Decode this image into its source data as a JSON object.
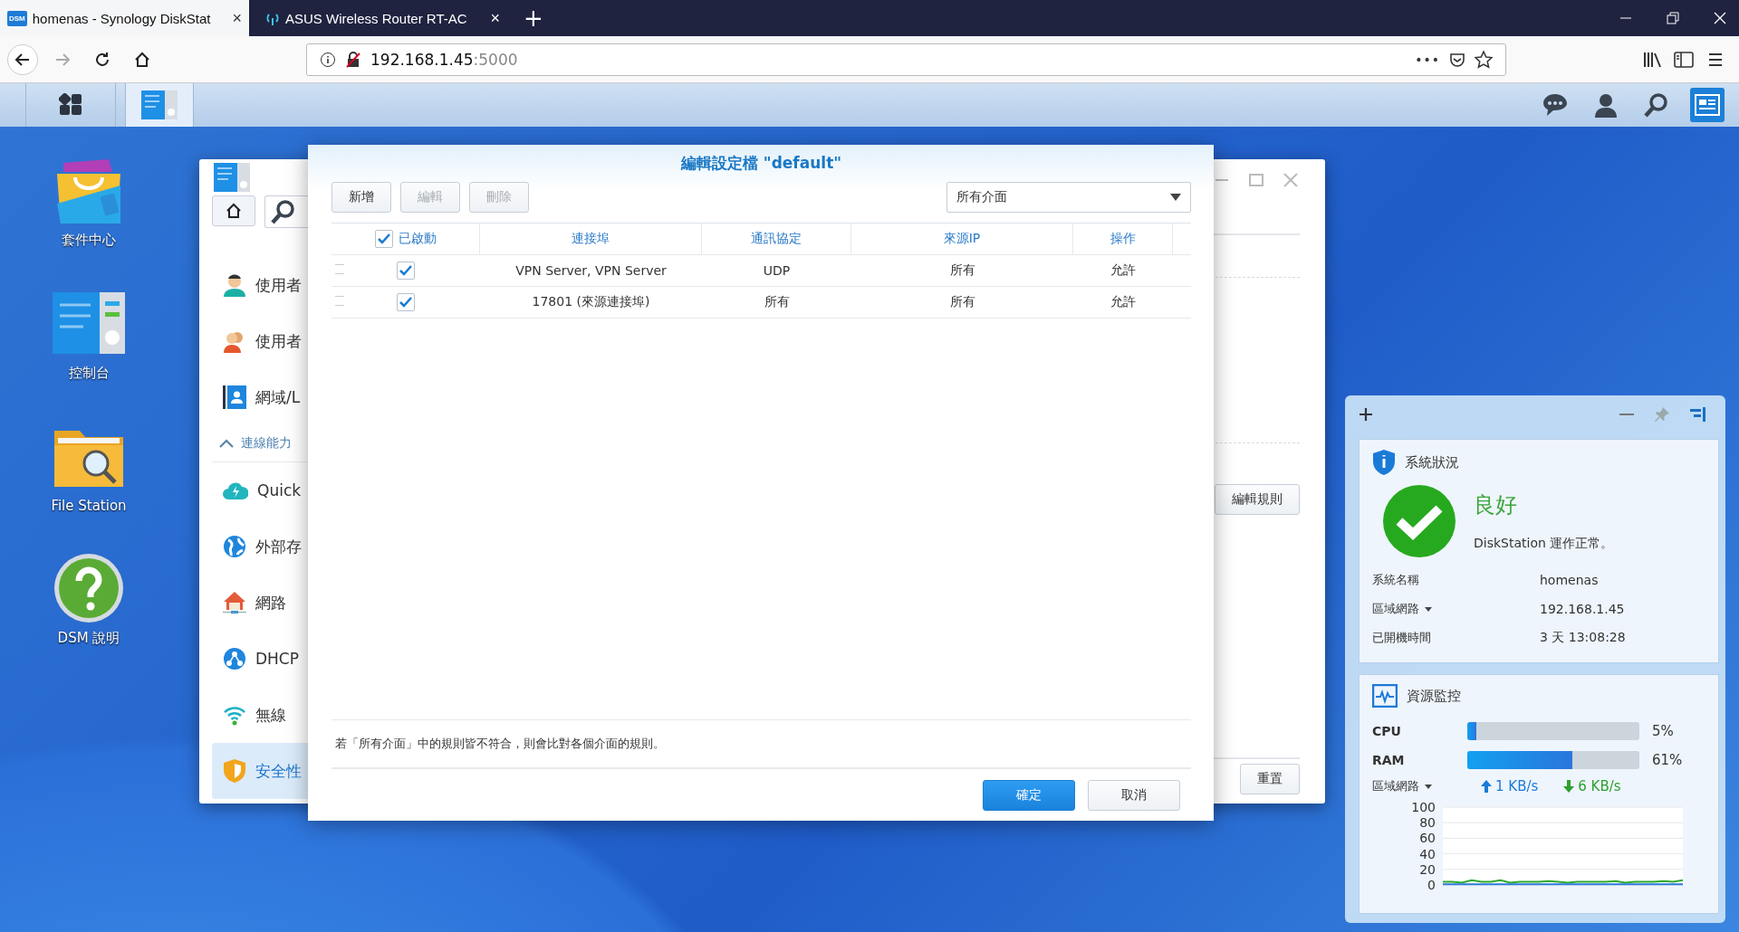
{
  "browser": {
    "tabs": [
      {
        "favicon": "DSM",
        "title": "homenas - Synology DiskStat",
        "close": "×",
        "selected": true
      },
      {
        "title": "ASUS Wireless Router RT-AC",
        "close": "×",
        "selected": false
      }
    ],
    "new_tab": "+",
    "nav": [
      {
        "kind": "back",
        "disabled": false
      },
      {
        "kind": "forward",
        "disabled": true
      },
      {
        "kind": "reload",
        "disabled": false
      },
      {
        "kind": "home",
        "disabled": false
      }
    ],
    "address": {
      "host": "192.168.1.45",
      "port": ":5000"
    },
    "page_actions": "•••"
  },
  "taskbar": {
    "apps": [
      {
        "kind": "main-menu",
        "selected": false
      },
      {
        "kind": "control-panel",
        "selected": true
      }
    ],
    "tray": [
      {
        "kind": "chat",
        "selected": false
      },
      {
        "kind": "user",
        "selected": false
      },
      {
        "kind": "search",
        "selected": false
      },
      {
        "kind": "widgets",
        "selected": true
      }
    ]
  },
  "desktop_icons": [
    {
      "kind": "package",
      "label": "套件中心"
    },
    {
      "kind": "control",
      "label": "控制台"
    },
    {
      "kind": "folder",
      "label": "File Station"
    },
    {
      "kind": "help",
      "label": "DSM 說明"
    }
  ],
  "control_panel": {
    "sidebar": [
      {
        "kind": "user",
        "label": "使用者",
        "selected": false
      },
      {
        "kind": "group",
        "label": "使用者",
        "selected": false
      },
      {
        "kind": "domain",
        "label": "網域/L",
        "selected": false
      },
      {
        "kind": "section",
        "label": "連線能力",
        "expanded": true
      },
      {
        "kind": "cloud",
        "label": "Quick",
        "selected": false
      },
      {
        "kind": "globe",
        "label": "外部存",
        "selected": false
      },
      {
        "kind": "house",
        "label": "網路",
        "selected": false
      },
      {
        "kind": "dhcp",
        "label": "DHCP",
        "selected": false
      },
      {
        "kind": "wifi",
        "label": "無線",
        "selected": false
      },
      {
        "kind": "shield",
        "label": "安全性",
        "selected": true
      }
    ],
    "buttons": [
      "編輯規則",
      "重置"
    ]
  },
  "dialog": {
    "title": "編輯設定檔 \"default\"",
    "toolbar": [
      {
        "label": "新增",
        "disabled": false
      },
      {
        "label": "編輯",
        "disabled": true
      },
      {
        "label": "刪除",
        "disabled": true
      }
    ],
    "interface_select": {
      "value": "所有介面"
    },
    "header_checked": true,
    "columns": [
      "已啟動",
      "連接埠",
      "通訊協定",
      "來源IP",
      "操作"
    ],
    "rows": [
      {
        "enabled": true,
        "cells": [
          "",
          "VPN Server, VPN Server",
          "UDP",
          "所有",
          "允許"
        ]
      },
      {
        "enabled": true,
        "cells": [
          "",
          "17801 (來源連接埠)",
          "所有",
          "所有",
          "允許"
        ]
      }
    ],
    "note": "若「所有介面」中的規則皆不符合，則會比對各個介面的規則。",
    "buttons": [
      {
        "label": "確定",
        "kind": "primary"
      },
      {
        "label": "取消",
        "kind": "secondary"
      }
    ]
  },
  "widgets": {
    "system": {
      "title": "系統狀況",
      "status": "良好",
      "message": "DiskStation 運作正常。",
      "rows": [
        {
          "label": "系統名稱",
          "value": "homenas",
          "dropdown": false
        },
        {
          "label": "區域網路",
          "value": "192.168.1.45",
          "dropdown": true
        },
        {
          "label": "已開機時間",
          "value": "3 天 13:08:28",
          "dropdown": false
        }
      ]
    },
    "resources": {
      "title": "資源監控",
      "meters": [
        {
          "label": "CPU",
          "level": 0.05,
          "reading": "5%"
        },
        {
          "label": "RAM",
          "level": 0.61,
          "reading": "61%"
        }
      ],
      "network": {
        "label": "區域網路",
        "upload": "1 KB/s",
        "download": "6 KB/s"
      },
      "chart_data": {
        "type": "line",
        "grid": true,
        "ylim": [
          0,
          100
        ],
        "yticks": [
          0,
          20,
          40,
          60,
          80,
          100
        ],
        "series": [
          {
            "color": "#2eaa2e",
            "values": [
              4,
              4,
              3,
              6,
              4,
              4,
              6,
              3,
              4,
              4,
              4,
              5,
              4,
              3,
              4,
              4,
              4,
              4,
              5,
              3,
              4,
              4,
              4,
              5,
              4,
              6
            ]
          },
          {
            "color": "#2a7ad8",
            "values": [
              1,
              1,
              1,
              1,
              1,
              1,
              1,
              1,
              1,
              1,
              1,
              1,
              1,
              1,
              1,
              1,
              1,
              1,
              1,
              1,
              1,
              1,
              1,
              1,
              1,
              1
            ]
          }
        ]
      }
    }
  }
}
